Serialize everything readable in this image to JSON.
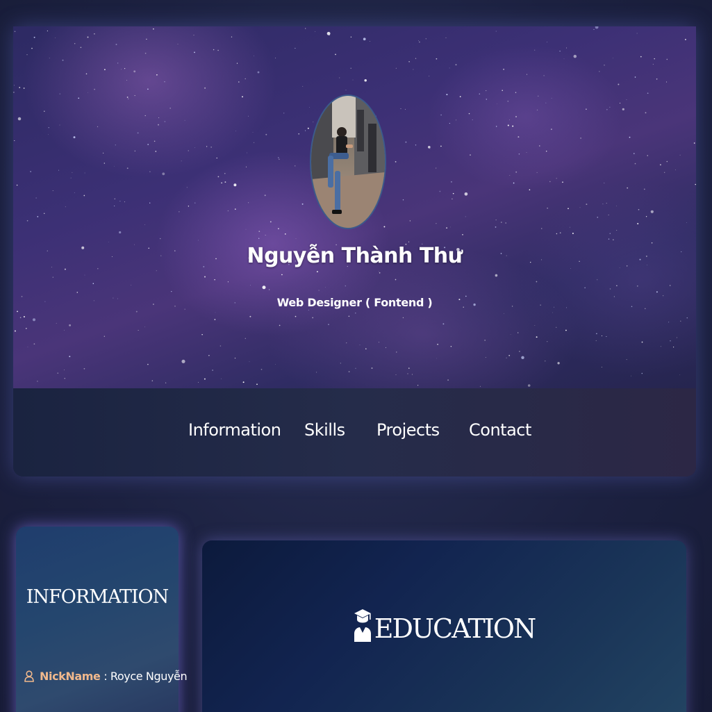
{
  "profile": {
    "name": "Nguyễn Thành Thư",
    "role": "Web Designer ( Fontend )",
    "avatar_icon": "profile-photo"
  },
  "nav": {
    "items": [
      {
        "label": "Information"
      },
      {
        "label": "Skills"
      },
      {
        "label": "Projects"
      },
      {
        "label": "Contact"
      }
    ]
  },
  "information": {
    "title": "INFORMATION",
    "nickname_label": "NickName",
    "nickname_separator": " : ",
    "nickname_value": "Royce Nguyễn",
    "nickname_icon": "user-icon"
  },
  "education": {
    "title": "EDUCATION",
    "icon": "graduate-icon"
  },
  "colors": {
    "background": "#1d2340",
    "accent_label": "#f0b88c",
    "navbar": "#232a48",
    "text": "#ffffff"
  }
}
